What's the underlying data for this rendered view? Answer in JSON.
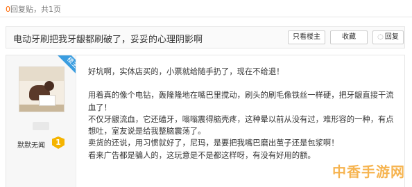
{
  "topbar": {
    "reply_count_num": "0",
    "reply_count_label": "回复贴，共1页"
  },
  "thread": {
    "title": "电动牙刷把我牙龈都刷破了，妥妥的心理阴影啊",
    "buttons": {
      "only_op": "只看楼主",
      "favorite": "收藏",
      "reply": "回复"
    }
  },
  "post": {
    "corner_badge": "楼主",
    "user_level": "默默无闻",
    "level_number": "1",
    "paragraphs": [
      "好坑啊，实体店买的，小票就给随手扔了，现在不给退！",
      "",
      "用着真的像个电钻，轰隆隆地在嘴巴里搅动，刷头的刷毛像铁丝一样硬，把牙龈直接干流血了！",
      "不仅牙龈流血，它还磕牙，嗡嗡震得脑壳疼，这种晕以前从没有过，难形容的一种，有点想吐，室友说是给我整脑震荡了。",
      "卖货的还说，用习惯就好了，尼玛，是要把我嘴巴磨出茧子还是包浆啊！",
      "看来广告都是骗人的，这玩意是不是都这样呀，有没有好用的额。"
    ]
  },
  "watermark": "中香手游网"
}
